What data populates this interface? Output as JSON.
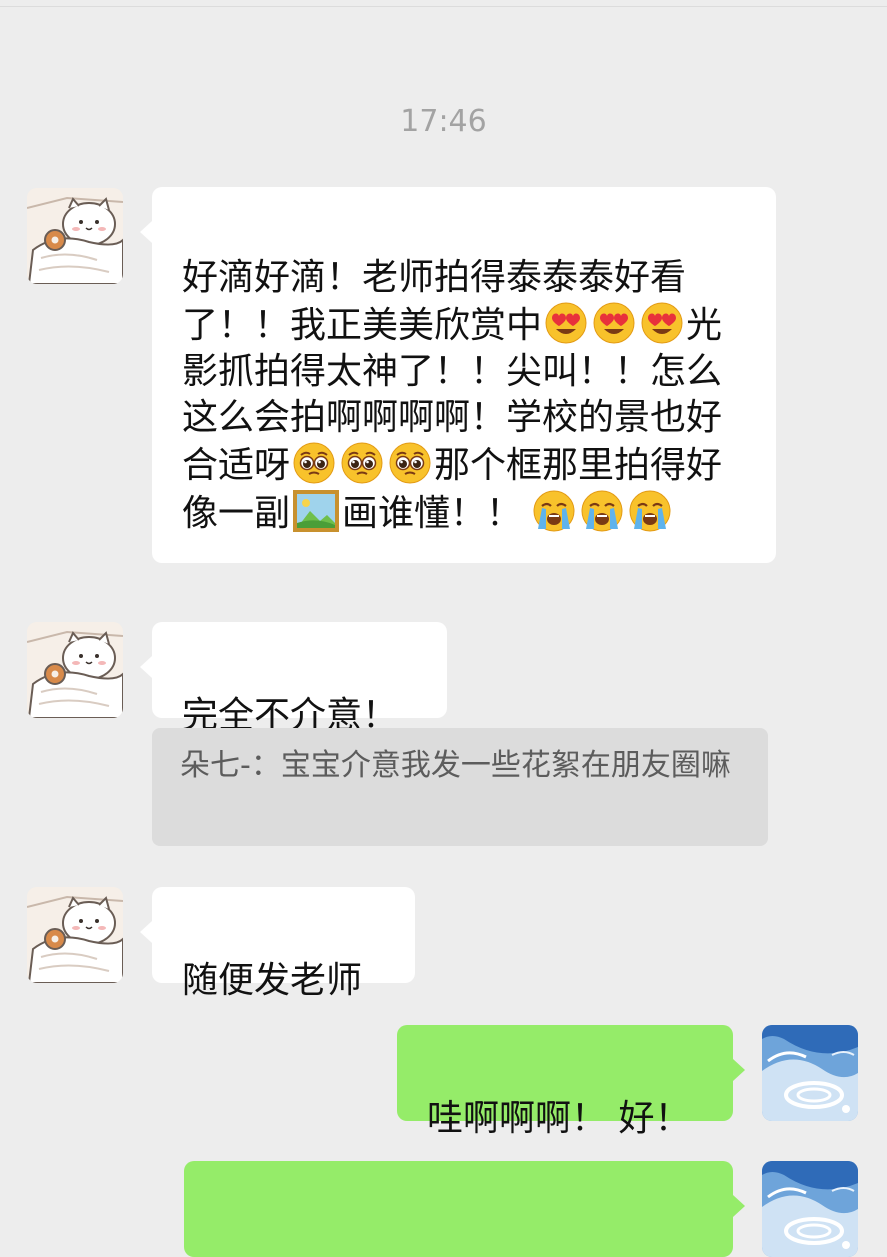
{
  "chat": {
    "timestamp": "17:46",
    "messages": [
      {
        "sender": "other",
        "avatar": "cartoon-cat-avatar",
        "segments": {
          "s1": "好滴好滴！老师拍得泰泰泰好看了！！我正美美欣赏中",
          "s2": "光影抓拍得太神了！！尖叫！！怎么这么会拍啊啊啊啊！学校的景也好合适呀",
          "s3": "那个框那里拍得好像一副",
          "s4": "画谁懂！！"
        },
        "emojis": [
          "smiling-face-with-heart-eyes",
          "face-holding-back-tears",
          "framed-picture",
          "loudly-crying-face"
        ]
      },
      {
        "sender": "other",
        "avatar": "cartoon-cat-avatar",
        "text": "完全不介意！",
        "quote": {
          "text": "朵七-：宝宝介意我发一些花絮在朋友圈嘛"
        }
      },
      {
        "sender": "other",
        "avatar": "cartoon-cat-avatar",
        "text": "随便发老师"
      },
      {
        "sender": "self",
        "avatar": "blue-water-avatar",
        "text": "哇啊啊啊！ 好！"
      },
      {
        "sender": "self",
        "avatar": "blue-water-avatar",
        "text": ""
      }
    ]
  },
  "colors": {
    "background": "#ededed",
    "bubble_other": "#ffffff",
    "bubble_self": "#95ec69",
    "quote_background": "#dcdcdc",
    "timestamp_text": "#a3a3a3"
  }
}
